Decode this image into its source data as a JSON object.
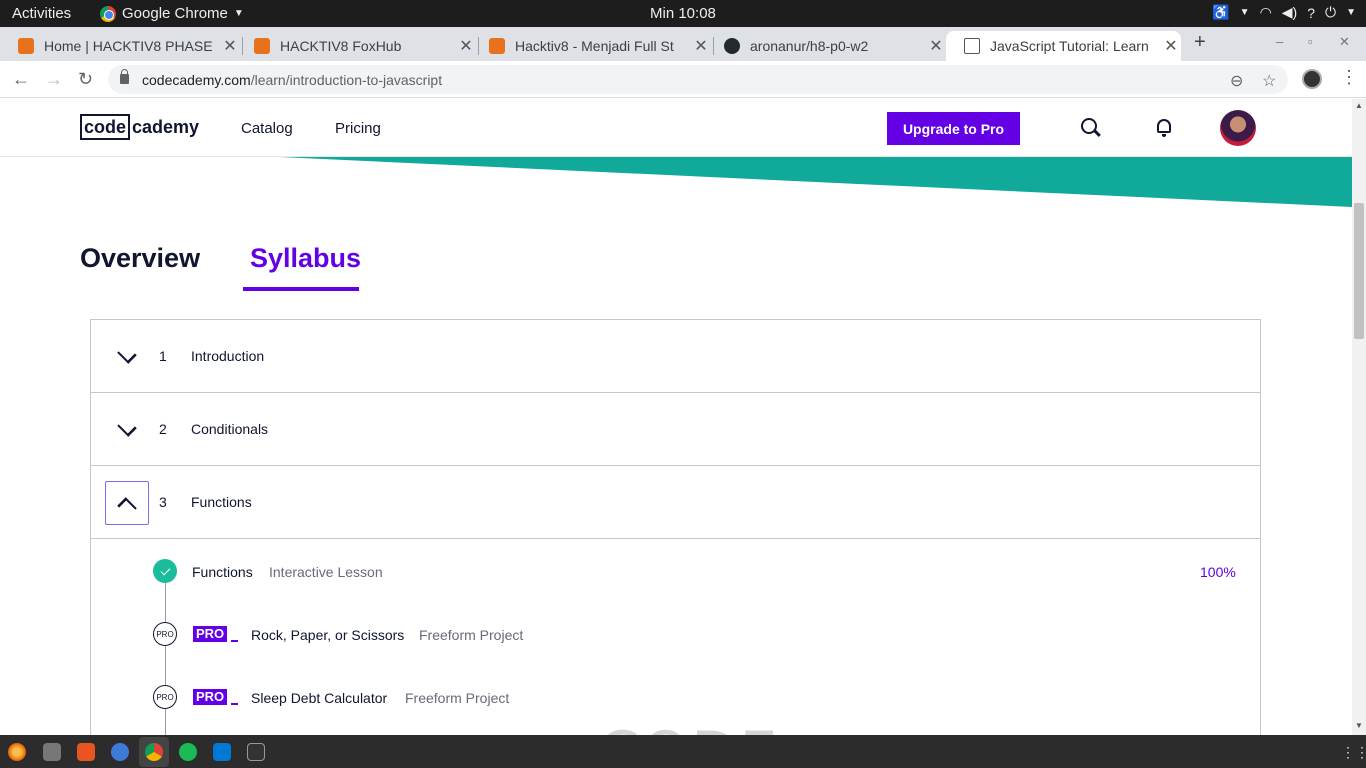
{
  "gnome": {
    "activities": "Activities",
    "app_name": "Google Chrome",
    "clock": "Min 10:08"
  },
  "tabs": [
    {
      "title": "Home | HACKTIV8 PHASE"
    },
    {
      "title": "HACKTIV8 FoxHub"
    },
    {
      "title": "Hacktiv8 - Menjadi Full St"
    },
    {
      "title": "aronanur/h8-p0-w2"
    },
    {
      "title": "JavaScript Tutorial: Learn"
    }
  ],
  "omnibox": {
    "host": "codecademy.com",
    "path": "/learn/introduction-to-javascript"
  },
  "site": {
    "logo_part1": "code",
    "logo_part2": "cademy",
    "nav": [
      "Catalog",
      "Pricing"
    ],
    "upgrade_label": "Upgrade to Pro",
    "brand_teal": "#10a99a",
    "brand_purple": "#6400e4"
  },
  "page_tabs": {
    "overview": "Overview",
    "syllabus": "Syllabus"
  },
  "modules": [
    {
      "number": "1",
      "name": "Introduction",
      "expanded": false
    },
    {
      "number": "2",
      "name": "Conditionals",
      "expanded": false
    },
    {
      "number": "3",
      "name": "Functions",
      "expanded": true
    }
  ],
  "lessons": [
    {
      "name": "Functions",
      "type": "Interactive Lesson",
      "progress": "100%",
      "status": "done"
    },
    {
      "name": "Rock, Paper, or Scissors",
      "type": "Freeform Project",
      "badge": "PRO",
      "dot_label": "PRO",
      "status": "pro"
    },
    {
      "name": "Sleep Debt Calculator",
      "type": "Freeform Project",
      "badge": "PRO",
      "dot_label": "PRO",
      "status": "pro"
    }
  ],
  "watermark": "CODE",
  "icons": {
    "gnome_tray": [
      "accessibility-icon",
      "wifi-icon",
      "volume-icon",
      "help-icon",
      "power-icon"
    ],
    "dock": [
      "firefox-icon",
      "files-icon",
      "software-icon",
      "help-icon",
      "chrome-icon",
      "spotify-icon",
      "vscode-icon",
      "terminal-icon",
      "app-grid-icon"
    ]
  }
}
